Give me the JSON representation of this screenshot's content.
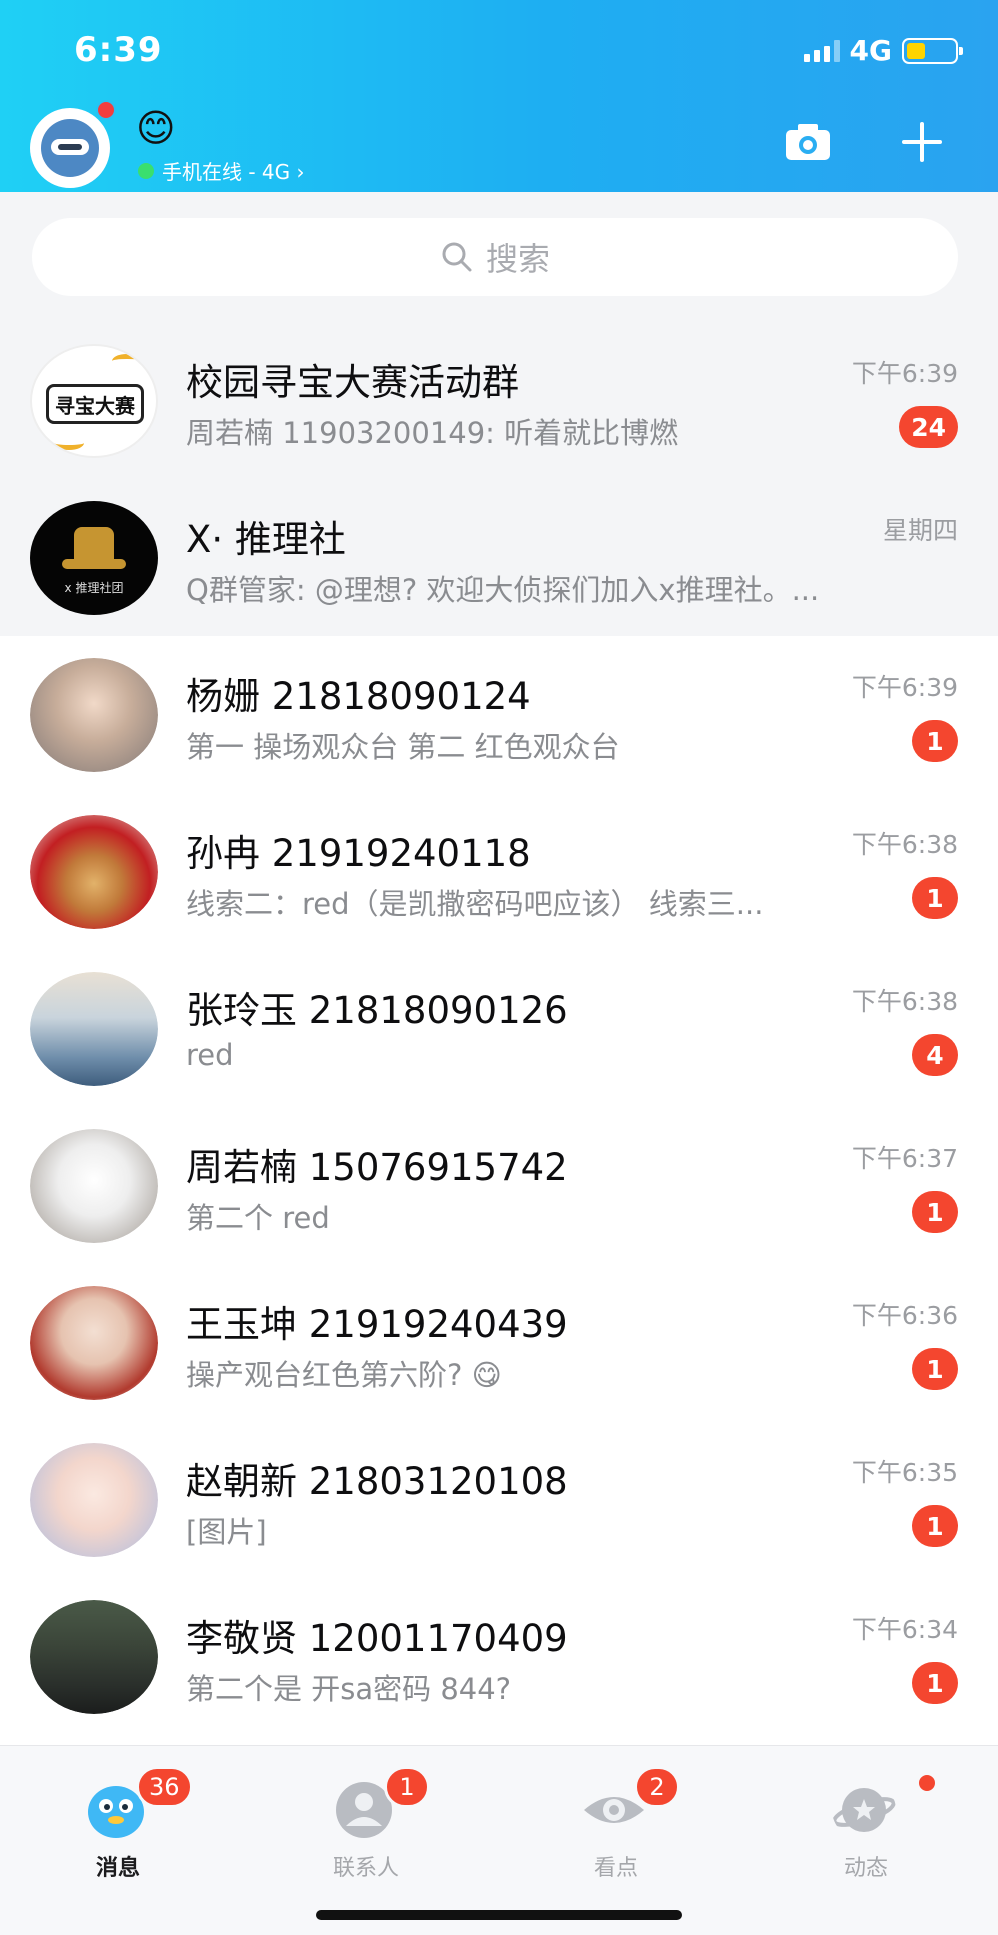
{
  "status_bar": {
    "time": "6:39",
    "network": "4G"
  },
  "header": {
    "mood_emoji": "😊",
    "online_status": "手机在线 - 4G ›"
  },
  "search": {
    "placeholder": "搜索"
  },
  "conversations": [
    {
      "name": "校园寻宝大赛活动群",
      "preview": "周若楠  11903200149: 听着就比博燃",
      "time": "下午6:39",
      "badge": "24",
      "pinned": true,
      "avatar_text": "寻宝大赛"
    },
    {
      "name": "X· 推理社",
      "preview": "Q群管家: @理想?  欢迎大侦探们加入x推理社。...",
      "time": "星期四",
      "badge": "",
      "pinned": true,
      "avatar_text": "x 推理社团"
    },
    {
      "name": "杨姗  21818090124",
      "preview": "第一   操场观众台 第二   红色观众台",
      "time": "下午6:39",
      "badge": "1",
      "pinned": false
    },
    {
      "name": "孙冉 21919240118",
      "preview": "线索二：red（是凯撒密码吧应该） 线索三...",
      "time": "下午6:38",
      "badge": "1",
      "pinned": false
    },
    {
      "name": "张玲玉 21818090126",
      "preview": "red",
      "time": "下午6:38",
      "badge": "4",
      "pinned": false
    },
    {
      "name": "周若楠  15076915742",
      "preview": "第二个  red",
      "time": "下午6:37",
      "badge": "1",
      "pinned": false
    },
    {
      "name": "王玉坤 21919240439",
      "preview": "操产观台红色第六阶? 😋",
      "time": "下午6:36",
      "badge": "1",
      "pinned": false
    },
    {
      "name": "赵朝新 21803120108",
      "preview": "[图片]",
      "time": "下午6:35",
      "badge": "1",
      "pinned": false
    },
    {
      "name": "李敬贤 12001170409",
      "preview": "第二个是 开sa密码 844?",
      "time": "下午6:34",
      "badge": "1",
      "pinned": false
    }
  ],
  "tabs": [
    {
      "label": "消息",
      "badge": "36",
      "active": true,
      "icon": "penguin-icon"
    },
    {
      "label": "联系人",
      "badge": "1",
      "active": false,
      "icon": "contacts-icon"
    },
    {
      "label": "看点",
      "badge": "2",
      "active": false,
      "icon": "eye-icon"
    },
    {
      "label": "动态",
      "badge": "",
      "active": false,
      "icon": "planet-icon"
    }
  ],
  "colors": {
    "header_start": "#1fd0f5",
    "header_end": "#2aa3f0",
    "badge_red": "#f4462f",
    "pinned_bg": "#f4f5f7"
  }
}
